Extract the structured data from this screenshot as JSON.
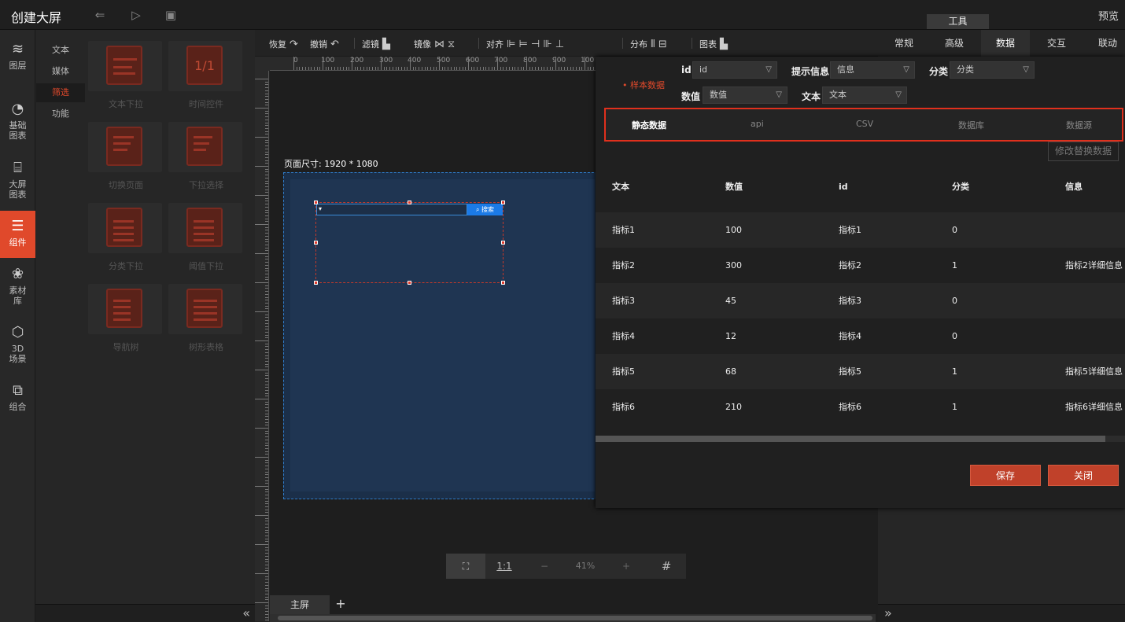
{
  "app": {
    "title": "创建大屏",
    "preview": "预览",
    "tools_tab": "工具"
  },
  "rail": [
    {
      "label": "图层",
      "icon": "layers-icon"
    },
    {
      "label": "基础\n图表",
      "icon": "pie-chart-icon"
    },
    {
      "label": "大屏\n图表",
      "icon": "monitor-chart-icon"
    },
    {
      "label": "组件",
      "icon": "sliders-icon"
    },
    {
      "label": "素材\n库",
      "icon": "cubes-icon"
    },
    {
      "label": "3D\n场景",
      "icon": "cube-3d-icon"
    },
    {
      "label": "组合",
      "icon": "group-icon"
    }
  ],
  "submenu": [
    "文本",
    "媒体",
    "筛选",
    "功能"
  ],
  "components": [
    "文本下拉",
    "时间控件",
    "切换页面",
    "下拉选择",
    "分类下拉",
    "阈值下拉",
    "导航树",
    "树形表格"
  ],
  "time_glyph": "1/1",
  "toolbar": {
    "restore": "恢复",
    "undo": "撤销",
    "filter": "滤镜",
    "mirror": "镜像",
    "align": "对齐",
    "distribute": "分布",
    "chart": "图表"
  },
  "ruler_labels": [
    "0",
    "100",
    "200",
    "300",
    "400",
    "500",
    "600",
    "700",
    "800",
    "900",
    "100"
  ],
  "canvas": {
    "page_size": "页面尺寸: 1920 * 1080",
    "search_btn": "搜索"
  },
  "zoom": {
    "one_to_one": "1:1",
    "minus": "−",
    "value": "41%",
    "plus": "+"
  },
  "screen_tab": "主屏",
  "add_screen": "+",
  "right_tabs": [
    "常规",
    "高级",
    "数据",
    "交互",
    "联动"
  ],
  "dialog": {
    "fields": {
      "id_label": "id",
      "id_value": "id",
      "tip_label": "提示信息",
      "tip_value": "信息",
      "cat_label": "分类",
      "cat_value": "分类",
      "val_label": "数值",
      "val_value": "数值",
      "text_label": "文本",
      "text_value": "文本"
    },
    "sample_note": "• 样本数据",
    "source_tabs": [
      "静态数据",
      "api",
      "CSV",
      "数据库",
      "数据源"
    ],
    "edit_button": "修改替换数据",
    "columns": [
      "文本",
      "数值",
      "id",
      "分类",
      "信息"
    ],
    "rows": [
      [
        "指标1",
        "100",
        "指标1",
        "0",
        ""
      ],
      [
        "指标2",
        "300",
        "指标2",
        "1",
        "指标2详细信息"
      ],
      [
        "指标3",
        "45",
        "指标3",
        "0",
        ""
      ],
      [
        "指标4",
        "12",
        "指标4",
        "0",
        ""
      ],
      [
        "指标5",
        "68",
        "指标5",
        "1",
        "指标5详细信息"
      ],
      [
        "指标6",
        "210",
        "指标6",
        "1",
        "指标6详细信息"
      ]
    ],
    "save": "保存",
    "close": "关闭"
  },
  "colors": {
    "accent": "#e0492b",
    "canvas_bg": "#1f3552",
    "primary_btn": "#1b7ae6"
  }
}
